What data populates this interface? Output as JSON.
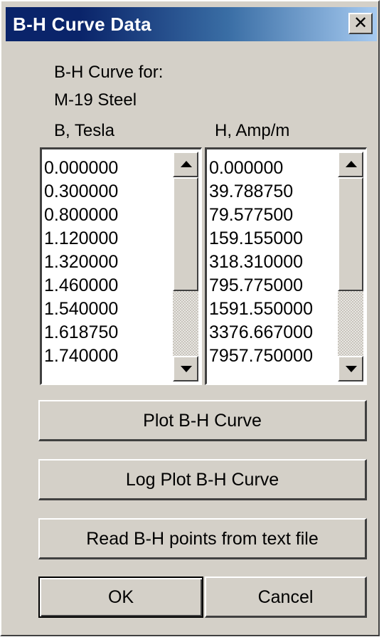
{
  "window": {
    "title": "B-H Curve Data",
    "close_glyph": "✕"
  },
  "header": {
    "curve_for_label": "B-H Curve for:",
    "material": "M-19 Steel",
    "b_column_label": "B, Tesla",
    "h_column_label": "H, Amp/m"
  },
  "b_list": {
    "items": [
      "0.000000",
      "0.300000",
      "0.800000",
      "1.120000",
      "1.320000",
      "1.460000",
      "1.540000",
      "1.618750",
      "1.740000"
    ]
  },
  "h_list": {
    "items": [
      "0.000000",
      "39.788750",
      "79.577500",
      "159.155000",
      "318.310000",
      "795.775000",
      "1591.550000",
      "3376.667000",
      "7957.750000"
    ]
  },
  "buttons": {
    "plot": "Plot B-H Curve",
    "log_plot": "Log Plot B-H Curve",
    "read_file": "Read B-H points from text file",
    "ok": "OK",
    "cancel": "Cancel"
  },
  "icons": {
    "close": "close-icon",
    "scroll_up": "scroll-up-arrow-icon",
    "scroll_down": "scroll-down-arrow-icon"
  },
  "colors": {
    "dialog_face": "#d4d0c8",
    "title_bar_start": "#0a246a",
    "title_bar_end": "#a6caf0",
    "title_text": "#ffffff"
  }
}
